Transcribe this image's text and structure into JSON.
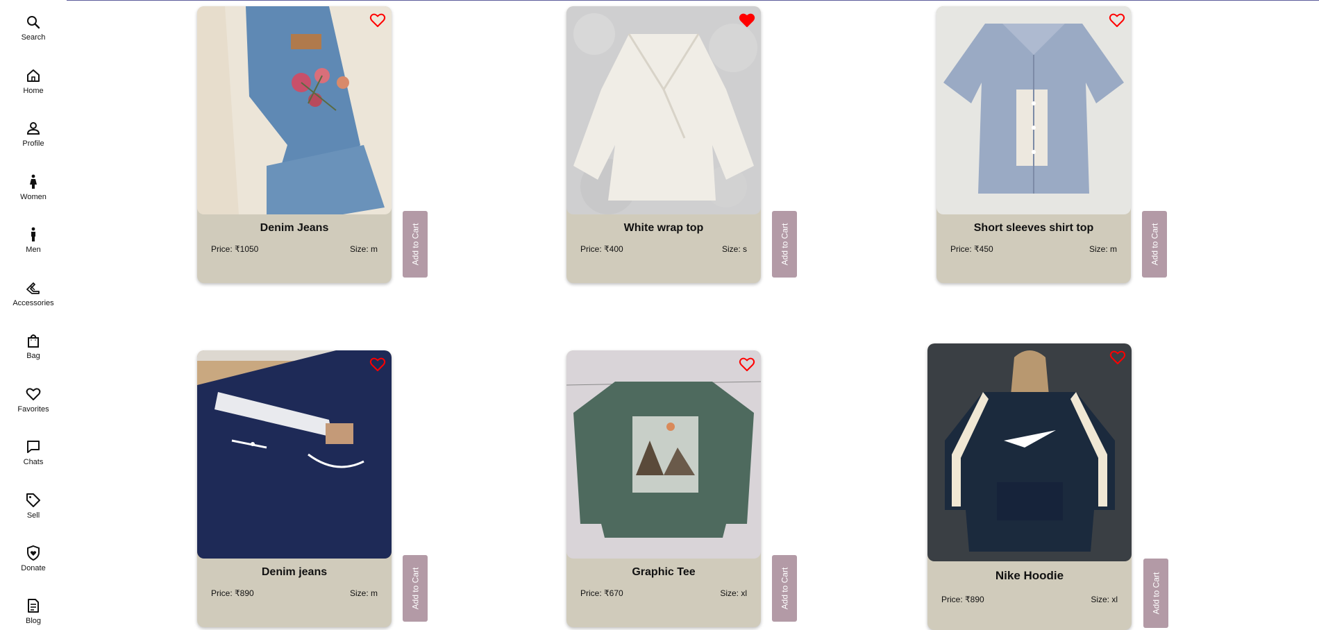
{
  "sidebar": {
    "items": [
      {
        "label": "Search",
        "icon": "search-icon"
      },
      {
        "label": "Home",
        "icon": "home-icon"
      },
      {
        "label": "Profile",
        "icon": "profile-icon"
      },
      {
        "label": "Women",
        "icon": "woman-icon"
      },
      {
        "label": "Men",
        "icon": "man-icon"
      },
      {
        "label": "Accessories",
        "icon": "accessories-icon"
      },
      {
        "label": "Bag",
        "icon": "bag-icon"
      },
      {
        "label": "Favorites",
        "icon": "heart-icon"
      },
      {
        "label": "Chats",
        "icon": "chat-icon"
      },
      {
        "label": "Sell",
        "icon": "tag-icon"
      },
      {
        "label": "Donate",
        "icon": "shield-heart-icon"
      },
      {
        "label": "Blog",
        "icon": "document-icon"
      }
    ]
  },
  "products": [
    {
      "title": "Denim Jeans",
      "price": "Price: ₹1050",
      "size": "Size: m",
      "favorited": false,
      "cart_label": "Add to Cart"
    },
    {
      "title": "White wrap top",
      "price": "Price: ₹400",
      "size": "Size: s",
      "favorited": true,
      "cart_label": "Add to Cart"
    },
    {
      "title": "Short sleeves shirt top",
      "price": "Price: ₹450",
      "size": "Size: m",
      "favorited": false,
      "cart_label": "Add to Cart"
    },
    {
      "title": "Denim jeans",
      "price": "Price: ₹890",
      "size": "Size: m",
      "favorited": false,
      "cart_label": "Add to Cart"
    },
    {
      "title": "Graphic Tee",
      "price": "Price: ₹670",
      "size": "Size: xl",
      "favorited": false,
      "cart_label": "Add to Cart"
    },
    {
      "title": "Nike Hoodie",
      "price": "Price: ₹890",
      "size": "Size: xl",
      "favorited": false,
      "cart_label": "Add to Cart"
    }
  ],
  "colors": {
    "card_bg": "#d0cbbb",
    "cart_button": "#b39aa6",
    "heart": "#ff0000"
  }
}
